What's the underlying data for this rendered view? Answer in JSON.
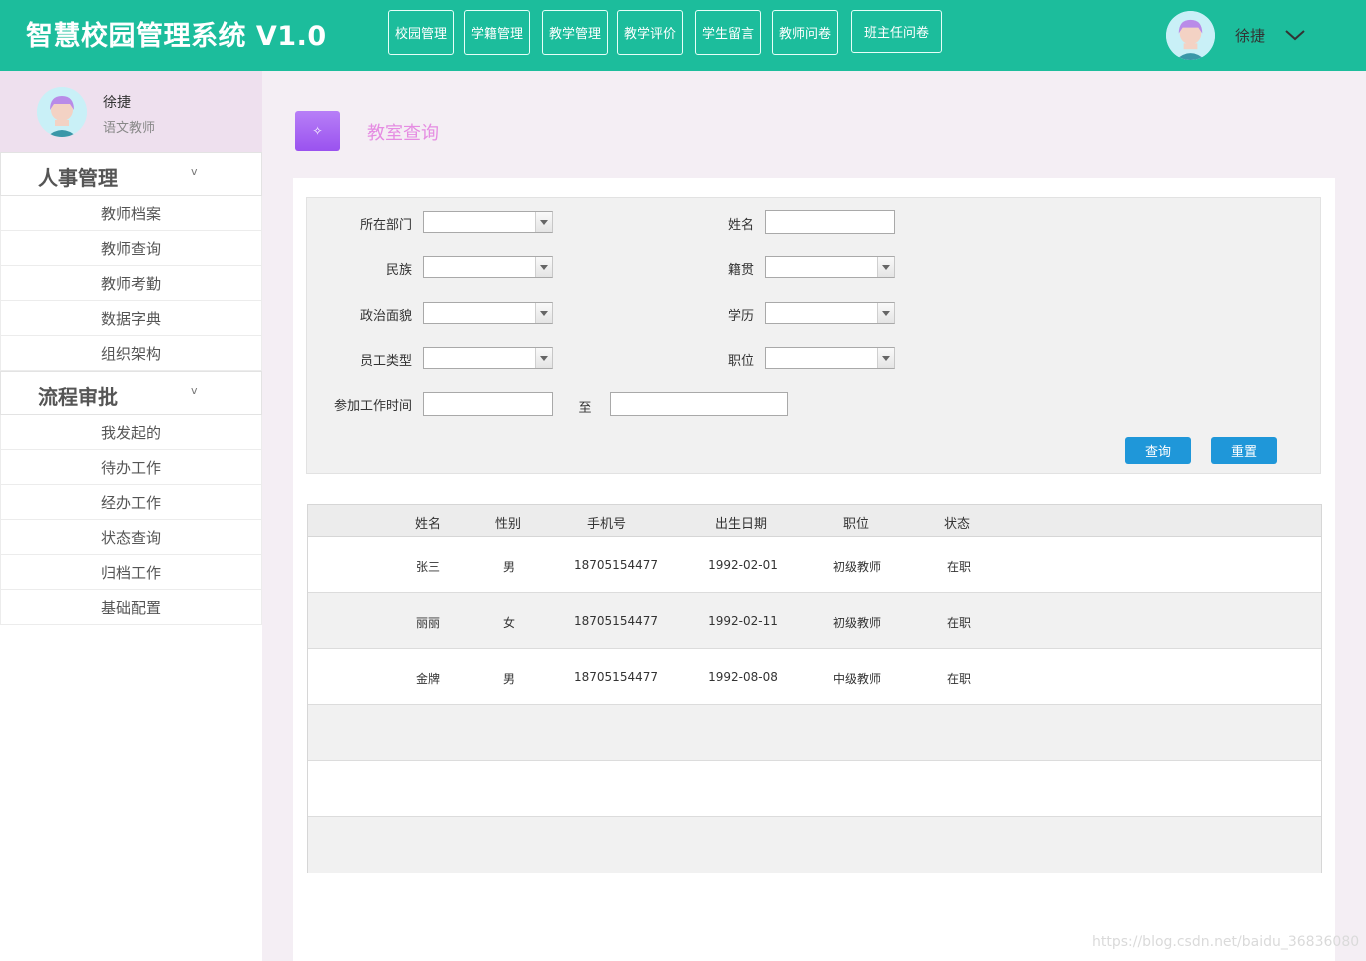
{
  "header": {
    "title": "智慧校园管理系统 V1.0",
    "nav": [
      "校园管理",
      "学籍管理",
      "教学管理",
      "教学评价",
      "学生留言",
      "教师问卷",
      "班主任问卷"
    ],
    "user_name": "徐捷"
  },
  "sidebar": {
    "profile": {
      "name": "徐捷",
      "role": "语文教师"
    },
    "groups": [
      {
        "title": "人事管理",
        "caret": "v",
        "items": [
          "教师档案",
          "教师查询",
          "教师考勤",
          "数据字典",
          "组织架构"
        ]
      },
      {
        "title": "流程审批",
        "caret": "v",
        "items": [
          "我发起的",
          "待办工作",
          "经办工作",
          "状态查询",
          "归档工作",
          "基础配置"
        ]
      }
    ]
  },
  "page": {
    "icon_glyph": "✧",
    "title": "教室查询"
  },
  "form": {
    "department_label": "所在部门",
    "name_label": "姓名",
    "ethnicity_label": "民族",
    "native_label": "籍贯",
    "political_label": "政治面貌",
    "education_label": "学历",
    "staff_type_label": "员工类型",
    "position_label": "职位",
    "work_time_label": "参加工作时间",
    "to_label": "至",
    "query_button": "查询",
    "reset_button": "重置"
  },
  "table": {
    "headers": [
      "姓名",
      "性别",
      "手机号",
      "出生日期",
      "职位",
      "状态"
    ],
    "rows": [
      [
        "张三",
        "男",
        "18705154477",
        "1992-02-01",
        "初级教师",
        "在职"
      ],
      [
        "丽丽",
        "女",
        "18705154477",
        "1992-02-11",
        "初级教师",
        "在职"
      ],
      [
        "金牌",
        "男",
        "18705154477",
        "1992-08-08",
        "中级教师",
        "在职"
      ]
    ]
  },
  "watermark": "https://blog.csdn.net/baidu_36836080"
}
